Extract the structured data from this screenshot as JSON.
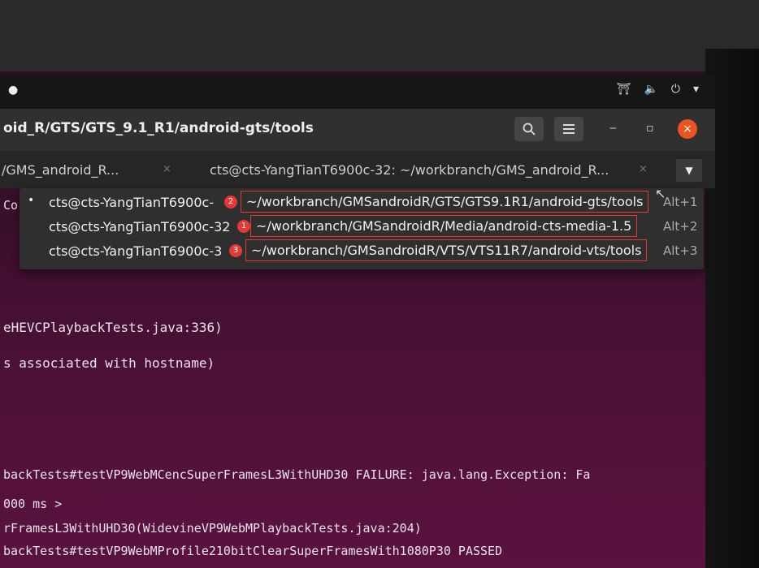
{
  "window": {
    "title": "oid_R/GTS/GTS_9.1_R1/android-gts/tools"
  },
  "header_buttons": {
    "search_icon": "search-icon",
    "menu_icon": "menu-icon",
    "minimize_label": "‒",
    "maximize_label": "▫",
    "close_label": "×"
  },
  "tabs": [
    {
      "label": "/GMS_android_R...",
      "close": "×"
    },
    {
      "label": "cts@cts-YangTianT6900c-32: ~/workbranch/GMS_android_R...",
      "close": "×"
    }
  ],
  "tab_menu": "▼",
  "popup": {
    "items": [
      {
        "active": true,
        "bullet": "•",
        "host": "cts@cts-YangTianT6900c-",
        "badge": "2",
        "path": "~/workbranch/GMSandroidR/GTS/GTS9.1R1/android-gts/tools",
        "shortcut": "Alt+1"
      },
      {
        "active": false,
        "bullet": "",
        "host": "cts@cts-YangTianT6900c-32",
        "badge": "1",
        "path": "~/workbranch/GMSandroidR/Media/android-cts-media-1.5",
        "shortcut": "Alt+2"
      },
      {
        "active": false,
        "bullet": "",
        "host": "cts@cts-YangTianT6900c-3",
        "badge": "3",
        "path": "~/workbranch/GMSandroidR/VTS/VTS11R7/android-vts/tools",
        "shortcut": "Alt+3"
      }
    ]
  },
  "terminal": {
    "side_label": "Co",
    "lines": [
      "eHEVCPlaybackTests.java:336)",
      "s associated with hostname)",
      "backTests#testVP9WebMCencSuperFramesL3WithUHD30 FAILURE: java.lang.Exception: Fa",
      "000 ms >",
      "rFramesL3WithUHD30(WidevineVP9WebMPlaybackTests.java:204)",
      "backTests#testVP9WebMProfile210bitClearSuperFramesWith1080P30 PASSED"
    ]
  },
  "colors": {
    "accent": "#e95420",
    "annotation": "#e53935",
    "terminal_bg": "#3a0f2b"
  }
}
